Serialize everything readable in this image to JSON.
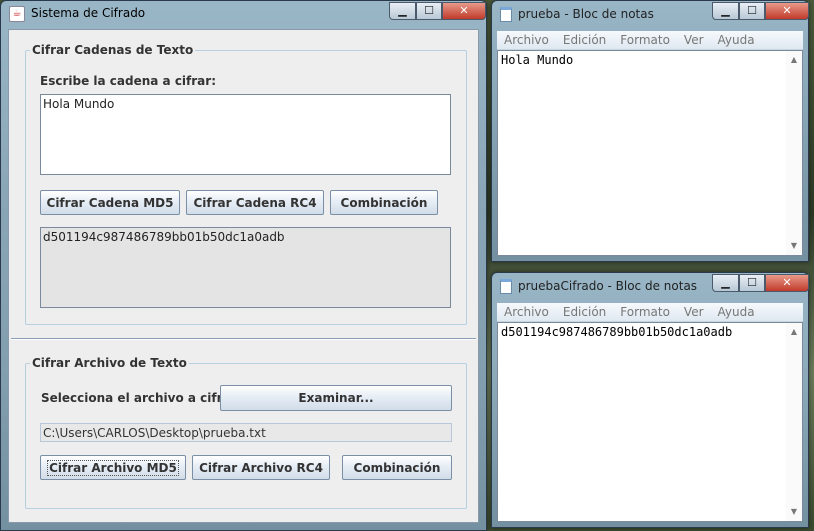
{
  "java_window": {
    "title": "Sistema de Cifrado",
    "controls": {
      "minimize": "▁",
      "maximize": "☐",
      "close": "✕"
    },
    "text_group": {
      "legend": "Cifrar Cadenas de Texto",
      "prompt_label": "Escribe la cadena a cifrar:",
      "input_value": "Hola Mundo",
      "buttons": {
        "md5": "Cifrar Cadena MD5",
        "rc4": "Cifrar Cadena RC4",
        "combo": "Combinación"
      },
      "output_value": "d501194c987486789bb01b50dc1a0adb"
    },
    "file_group": {
      "legend": "Cifrar Archivo de Texto",
      "select_label": "Selecciona el archivo a cifrar:",
      "browse_button": "Examinar...",
      "file_path": "C:\\Users\\CARLOS\\Desktop\\prueba.txt",
      "buttons": {
        "md5": "Cifrar Archivo MD5",
        "rc4": "Cifrar Archivo RC4",
        "combo": "Combinación"
      }
    }
  },
  "notepad_top": {
    "title": "prueba - Bloc de notas",
    "menu": [
      "Archivo",
      "Edición",
      "Formato",
      "Ver",
      "Ayuda"
    ],
    "content": "Hola Mundo"
  },
  "notepad_bottom": {
    "title": "pruebaCifrado - Bloc de notas",
    "menu": [
      "Archivo",
      "Edición",
      "Formato",
      "Ver",
      "Ayuda"
    ],
    "content": "d501194c987486789bb01b50dc1a0adb"
  },
  "icons": {
    "java": "java-cup-icon",
    "notepad": "notepad-icon",
    "scroll_up": "▲",
    "scroll_down": "▼"
  },
  "colors": {
    "titlebar": "#a0bed2",
    "close_button": "#c03a2a",
    "button_border": "#7a8fa6",
    "group_border": "#b8cfe0"
  }
}
